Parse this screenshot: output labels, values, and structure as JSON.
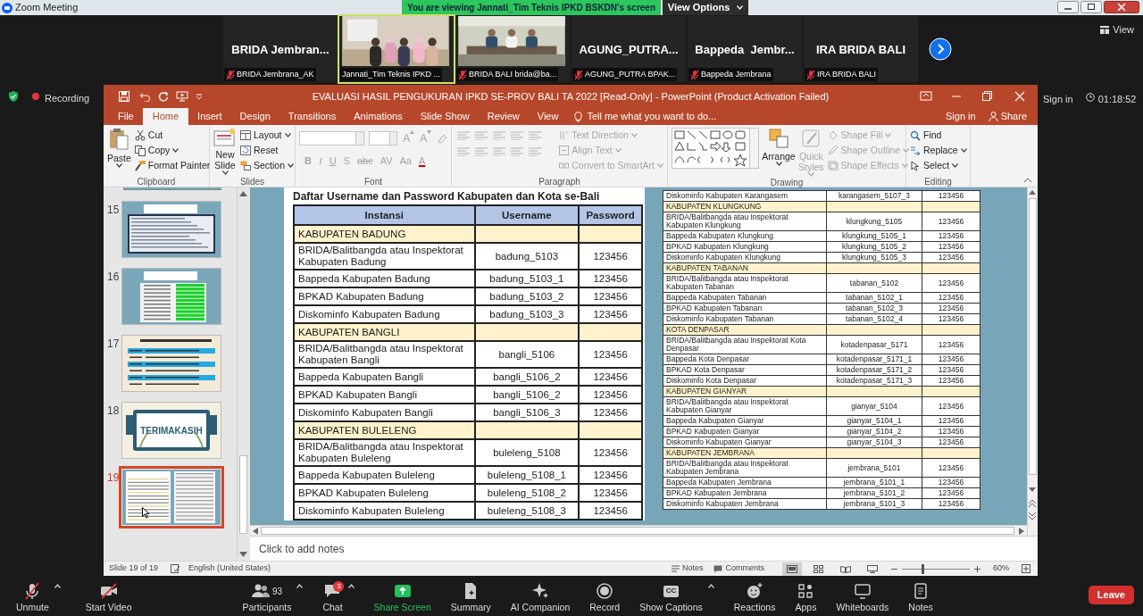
{
  "zoom_window": {
    "title": "Zoom Meeting",
    "banner": "You are viewing Jannati_Tim Teknis IPKD BSKDN's screen",
    "view_options": "View Options"
  },
  "participants": [
    {
      "kind": "name",
      "display": "BRIDA Jembran...",
      "label": "BRIDA Jembrana_AK",
      "muted": true,
      "speaking": false
    },
    {
      "kind": "video",
      "label": "Jannati_Tim Teknis IPKD ...",
      "muted": false,
      "speaking": true
    },
    {
      "kind": "video",
      "label": "BRIDA BALI brida@ba...",
      "muted": true,
      "speaking": false
    },
    {
      "kind": "name",
      "display": "AGUNG_PUTRA...",
      "label": "AGUNG_PUTRA BPAK...",
      "muted": true,
      "speaking": false
    },
    {
      "kind": "name",
      "display": "Bappeda  Jembr...",
      "label": "Bappeda Jembrana",
      "muted": true,
      "speaking": false
    },
    {
      "kind": "name",
      "display": "IRA BRIDA BALI",
      "label": "IRA BRIDA BALI",
      "muted": true,
      "speaking": false
    }
  ],
  "view_button": "View",
  "recording": "Recording",
  "sign_in": "Sign in",
  "elapsed": "01:18:52",
  "powerpoint": {
    "title": "EVALUASI HASIL PENGUKURAN IPKD SE-PROV BALI TA 2022 [Read-Only] - PowerPoint (Product Activation Failed)",
    "tabs": [
      {
        "label": "File",
        "selected": false
      },
      {
        "label": "Home",
        "selected": true
      },
      {
        "label": "Insert",
        "selected": false
      },
      {
        "label": "Design",
        "selected": false
      },
      {
        "label": "Transitions",
        "selected": false
      },
      {
        "label": "Animations",
        "selected": false
      },
      {
        "label": "Slide Show",
        "selected": false
      },
      {
        "label": "Review",
        "selected": false
      },
      {
        "label": "View",
        "selected": false
      }
    ],
    "tell_me": "Tell me what you want to do...",
    "sign_in": "Sign in",
    "share": "Share",
    "ribbon": {
      "clipboard": {
        "label": "Clipboard",
        "paste": "Paste",
        "cut": "Cut",
        "copy": "Copy",
        "format_painter": "Format Painter"
      },
      "slides": {
        "label": "Slides",
        "new_slide": "New Slide",
        "layout": "Layout",
        "reset": "Reset",
        "section": "Section"
      },
      "font": {
        "label": "Font",
        "disabled": true,
        "grow_shrink": [
          "A",
          "A"
        ],
        "buttons": [
          "B",
          "I",
          "U",
          "S",
          "abc",
          "AV",
          "Aa",
          "A"
        ]
      },
      "paragraph": {
        "label": "Paragraph",
        "disabled": true,
        "text_direction": "Text Direction",
        "align_text": "Align Text",
        "convert": "Convert to SmartArt"
      },
      "drawing": {
        "label": "Drawing",
        "arrange": "Arrange",
        "quick_styles": "Quick Styles",
        "shape_fill": "Shape Fill",
        "shape_outline": "Shape Outline",
        "shape_effects": "Shape Effects",
        "styles_disabled": true
      },
      "editing": {
        "label": "Editing",
        "find": "Find",
        "replace": "Replace",
        "select": "Select"
      }
    },
    "thumbnails": [
      {
        "number": "15",
        "kind": "table",
        "selected": false
      },
      {
        "number": "16",
        "kind": "green_table",
        "selected": false
      },
      {
        "number": "17",
        "kind": "list",
        "selected": false
      },
      {
        "number": "18",
        "kind": "closing",
        "text": "TERIMAKASIH",
        "selected": false
      },
      {
        "number": "19",
        "kind": "two_tables",
        "selected": true
      }
    ],
    "slide": {
      "heading": "Daftar Username dan Password Kabupaten dan Kota se-Bali",
      "columns": [
        "Instansi",
        "Username",
        "Password"
      ],
      "left_rows": [
        {
          "kind": "group",
          "label": "KABUPATEN BADUNG"
        },
        {
          "kind": "entry",
          "instansi": "BRIDA/Balitbangda atau Inspektorat Kabupaten Badung",
          "username": "badung_5103",
          "password": "123456"
        },
        {
          "kind": "entry",
          "instansi": "Bappeda Kabupaten Badung",
          "username": "badung_5103_1",
          "password": "123456"
        },
        {
          "kind": "entry",
          "instansi": "BPKAD Kabupaten Badung",
          "username": "badung_5103_2",
          "password": "123456"
        },
        {
          "kind": "entry",
          "instansi": "Diskominfo Kabupaten Badung",
          "username": "badung_5103_3",
          "password": "123456"
        },
        {
          "kind": "group",
          "label": "KABUPATEN BANGLI"
        },
        {
          "kind": "entry",
          "instansi": "BRIDA/Balitbangda atau Inspektorat Kabupaten Bangli",
          "username": "bangli_5106",
          "password": "123456"
        },
        {
          "kind": "entry",
          "instansi": "Bappeda Kabupaten Bangli",
          "username": "bangli_5106_2",
          "password": "123456"
        },
        {
          "kind": "entry",
          "instansi": "BPKAD Kabupaten Bangli",
          "username": "bangli_5106_2",
          "password": "123456"
        },
        {
          "kind": "entry",
          "instansi": "Diskominfo Kabupaten Bangli",
          "username": "bangli_5106_3",
          "password": "123456"
        },
        {
          "kind": "group",
          "label": "KABUPATEN BULELENG"
        },
        {
          "kind": "entry",
          "instansi": "BRIDA/Balitbangda atau Inspektorat Kabupaten Buleleng",
          "username": "buleleng_5108",
          "password": "123456"
        },
        {
          "kind": "entry",
          "instansi": "Bappeda Kabupaten Buleleng",
          "username": "buleleng_5108_1",
          "password": "123456"
        },
        {
          "kind": "entry",
          "instansi": "BPKAD Kabupaten Buleleng",
          "username": "buleleng_5108_2",
          "password": "123456"
        },
        {
          "kind": "entry",
          "instansi": "Diskominfo Kabupaten Buleleng",
          "username": "buleleng_5108_3",
          "password": "123456"
        }
      ],
      "right_rows": [
        {
          "kind": "entry",
          "instansi": "Diskominfo Kabupaten Karangasem",
          "username": "karangasem_5107_3",
          "password": "123456"
        },
        {
          "kind": "group",
          "label": "KABUPATEN KLUNGKUNG"
        },
        {
          "kind": "entry",
          "instansi": "BRIDA/Balitbangda atau Inspektorat Kabupaten Klungkung",
          "username": "klungkung_5105",
          "password": "123456"
        },
        {
          "kind": "entry",
          "instansi": "Bappeda Kabupaten Klungkung",
          "username": "klungkung_5105_1",
          "password": "123456"
        },
        {
          "kind": "entry",
          "instansi": "BPKAD Kabupaten Klungkung",
          "username": "klungkung_5105_2",
          "password": "123456"
        },
        {
          "kind": "entry",
          "instansi": "Diskominfo Kabupaten Klungkung",
          "username": "klungkung_5105_3",
          "password": "123456"
        },
        {
          "kind": "group",
          "label": "KABUPATEN TABANAN"
        },
        {
          "kind": "entry",
          "instansi": "BRIDA/Balitbangda atau Inspektorat Kabupaten Tabanan",
          "username": "tabanan_5102",
          "password": "123456"
        },
        {
          "kind": "entry",
          "instansi": "Bappeda Kabupaten Tabanan",
          "username": "tabanan_5102_1",
          "password": "123456"
        },
        {
          "kind": "entry",
          "instansi": "BPKAD Kabupaten Tabanan",
          "username": "tabanan_5102_3",
          "password": "123456"
        },
        {
          "kind": "entry",
          "instansi": "Diskominfo Kabupaten Tabanan",
          "username": "tabanan_5102_4",
          "password": "123456"
        },
        {
          "kind": "group",
          "label": "KOTA DENPASAR"
        },
        {
          "kind": "entry",
          "instansi": "BRIDA/Balitbangda atau Inspektorat Kota Denpasar",
          "username": "kotadenpasar_5171",
          "password": "123456"
        },
        {
          "kind": "entry",
          "instansi": "Bappeda Kota Denpasar",
          "username": "kotadenpasar_5171_1",
          "password": "123456"
        },
        {
          "kind": "entry",
          "instansi": "BPKAD Kota Denpasar",
          "username": "kotadenpasar_5171_2",
          "password": "123456"
        },
        {
          "kind": "entry",
          "instansi": "Diskominfo Kota Denpasar",
          "username": "kotadenpasar_5171_3",
          "password": "123456"
        },
        {
          "kind": "group",
          "label": "KABUPATEN GIANYAR"
        },
        {
          "kind": "entry",
          "instansi": "BRIDA/Balitbangda atau Inspektorat Kabupaten Gianyar",
          "username": "gianyar_5104",
          "password": "123456"
        },
        {
          "kind": "entry",
          "instansi": "Bappeda Kabupaten Gianyar",
          "username": "gianyar_5104_1",
          "password": "123456"
        },
        {
          "kind": "entry",
          "instansi": "BPKAD Kabupaten Gianyar",
          "username": "gianyar_5104_2",
          "password": "123456"
        },
        {
          "kind": "entry",
          "instansi": "Diskominfo Kabupaten Gianyar",
          "username": "gianyar_5104_3",
          "password": "123456"
        },
        {
          "kind": "group",
          "label": "KABUPATEN JEMBRANA"
        },
        {
          "kind": "entry",
          "instansi": "BRIDA/Balitbangda atau Inspektorat Kabupaten Jembrana",
          "username": "jembrana_5101",
          "password": "123456"
        },
        {
          "kind": "entry",
          "instansi": "Bappeda Kabupaten Jembrana",
          "username": "jembrana_5101_1",
          "password": "123456"
        },
        {
          "kind": "entry",
          "instansi": "BPKAD Kabupaten Jembrana",
          "username": "jembrana_5101_2",
          "password": "123456"
        },
        {
          "kind": "entry",
          "instansi": "Diskominfo Kabupaten Jembrana",
          "username": "jembrana_5101_3",
          "password": "123456"
        }
      ]
    },
    "notes_placeholder": "Click to add notes",
    "status": {
      "slide_counter": "Slide 19 of 19",
      "language": "English (United States)",
      "notes": "Notes",
      "comments": "Comments",
      "views": [
        {
          "kind": "normal",
          "selected": true
        },
        {
          "kind": "sorter",
          "selected": false
        },
        {
          "kind": "reading",
          "selected": false
        },
        {
          "kind": "show",
          "selected": false
        }
      ],
      "zoom": {
        "level": 0.3
      },
      "zoom_percent": "60%"
    }
  },
  "toolbar": {
    "left": [
      {
        "kind": "mic_off",
        "label": "Unmute",
        "caret": true
      },
      {
        "kind": "video_off",
        "label": "Start Video",
        "caret": false
      }
    ],
    "center": [
      {
        "kind": "participants",
        "label": "Participants",
        "count": "93",
        "caret": true
      },
      {
        "kind": "chat",
        "label": "Chat",
        "badge": "3",
        "caret": true
      },
      {
        "kind": "share",
        "label": "Share Screen",
        "caret": false
      },
      {
        "kind": "summary",
        "label": "Summary",
        "caret": false
      },
      {
        "kind": "ai",
        "label": "AI Companion",
        "caret": false
      },
      {
        "kind": "record",
        "label": "Record",
        "caret": false
      },
      {
        "kind": "captions",
        "label": "Show Captions",
        "icon_text": "CC",
        "caret": true
      },
      {
        "kind": "reactions",
        "label": "Reactions",
        "caret": false
      },
      {
        "kind": "apps",
        "label": "Apps",
        "caret": false
      },
      {
        "kind": "whiteboards",
        "label": "Whiteboards",
        "caret": false
      },
      {
        "kind": "notes",
        "label": "Notes",
        "caret": false
      }
    ],
    "leave": "Leave"
  }
}
